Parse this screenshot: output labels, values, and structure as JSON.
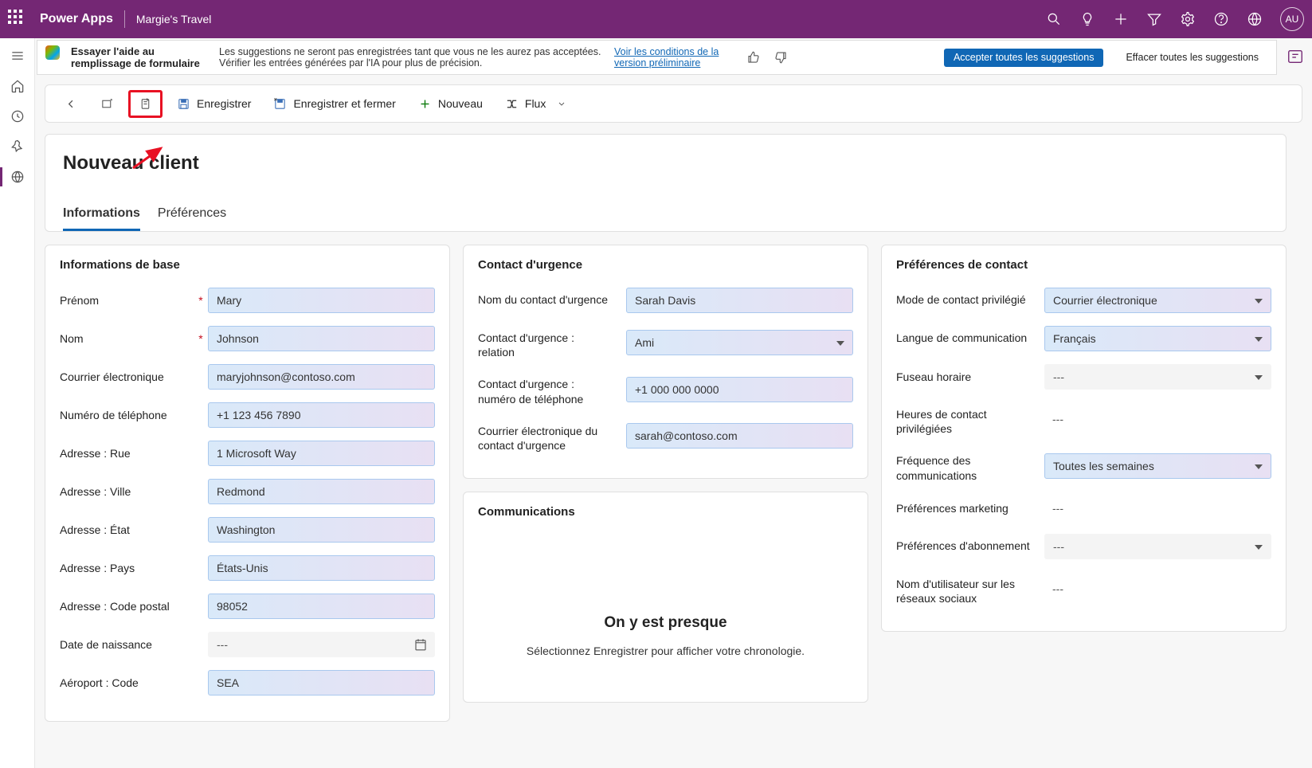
{
  "topbar": {
    "brand": "Power Apps",
    "env": "Margie's Travel",
    "avatar": "AU"
  },
  "banner": {
    "title": "Essayer l'aide au remplissage de formulaire",
    "text": "Les suggestions ne seront pas enregistrées tant que vous ne les aurez pas acceptées. Vérifier les entrées générées par l'IA pour plus de précision.",
    "link": "Voir les conditions de la version préliminaire",
    "accept": "Accepter toutes les suggestions",
    "clear": "Effacer toutes les suggestions"
  },
  "commands": {
    "save": "Enregistrer",
    "save_close": "Enregistrer et fermer",
    "new": "Nouveau",
    "flow": "Flux"
  },
  "page": {
    "title": "Nouveau client",
    "tab_info": "Informations",
    "tab_pref": "Préférences"
  },
  "sections": {
    "basic": {
      "title": "Informations de base",
      "f_firstname": "Prénom",
      "v_firstname": "Mary",
      "f_lastname": "Nom",
      "v_lastname": "Johnson",
      "f_email": "Courrier électronique",
      "v_email": "maryjohnson@contoso.com",
      "f_phone": "Numéro de téléphone",
      "v_phone": "+1 123 456 7890",
      "f_street": "Adresse : Rue",
      "v_street": "1 Microsoft Way",
      "f_city": "Adresse : Ville",
      "v_city": "Redmond",
      "f_state": "Adresse : État",
      "v_state": "Washington",
      "f_country": "Adresse : Pays",
      "v_country": "États-Unis",
      "f_zip": "Adresse : Code postal",
      "v_zip": "98052",
      "f_dob": "Date de naissance",
      "v_dob": "---",
      "f_airport": "Aéroport : Code",
      "v_airport": "SEA"
    },
    "emergency": {
      "title": "Contact d'urgence",
      "f_name": "Nom du contact d'urgence",
      "v_name": "Sarah Davis",
      "f_rel": "Contact d'urgence : relation",
      "v_rel": "Ami",
      "f_phone": "Contact d'urgence : numéro de téléphone",
      "v_phone": "+1 000 000 0000",
      "f_email": "Courrier électronique du contact d'urgence",
      "v_email": "sarah@contoso.com"
    },
    "comms": {
      "title": "Communications",
      "heading": "On y est presque",
      "text": "Sélectionnez Enregistrer pour afficher votre chronologie."
    },
    "prefs": {
      "title": "Préférences de contact",
      "f_mode": "Mode de contact privilégié",
      "v_mode": "Courrier électronique",
      "f_lang": "Langue de communication",
      "v_lang": "Français",
      "f_tz": "Fuseau horaire",
      "v_tz": "---",
      "f_hours": "Heures de contact privilégiées",
      "v_hours": "---",
      "f_freq": "Fréquence des communications",
      "v_freq": "Toutes les semaines",
      "f_mkt": "Préférences marketing",
      "v_mkt": "---",
      "f_sub": "Préférences d'abonnement",
      "v_sub": "---",
      "f_social": "Nom d'utilisateur sur les réseaux sociaux",
      "v_social": "---"
    }
  }
}
